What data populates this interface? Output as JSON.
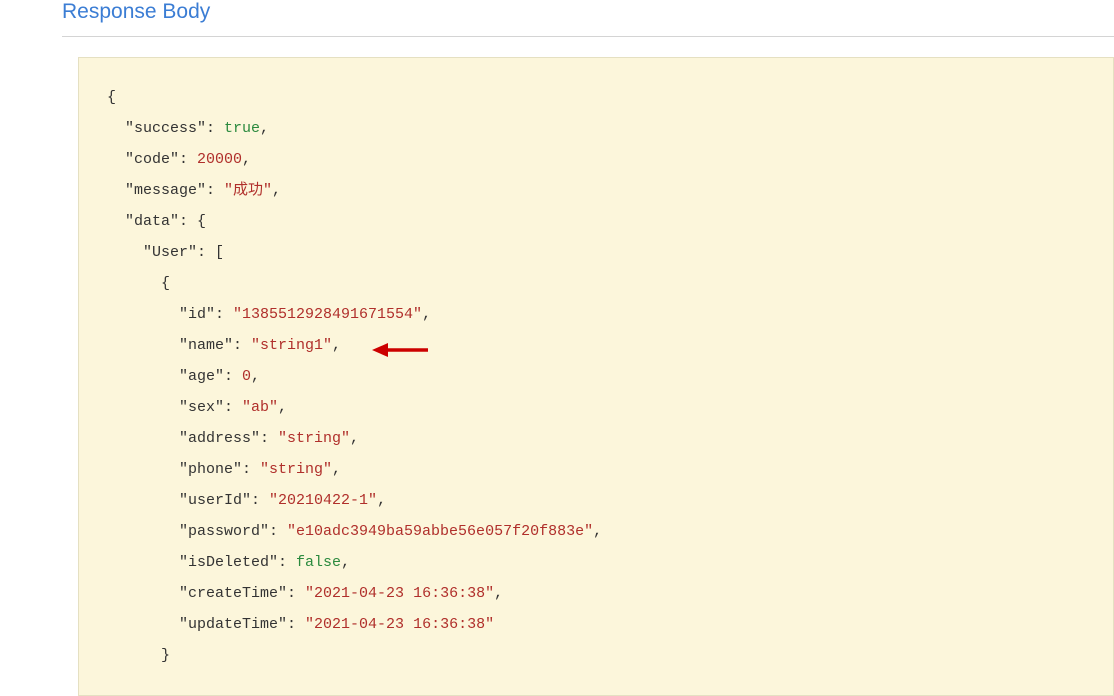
{
  "section": {
    "title": "Response Body"
  },
  "response": {
    "success_key": "\"success\"",
    "success_value": "true",
    "code_key": "\"code\"",
    "code_value": "20000",
    "message_key": "\"message\"",
    "message_value": "\"成功\"",
    "data_key": "\"data\"",
    "user_key": "\"User\"",
    "fields": {
      "id_key": "\"id\"",
      "id_value": "\"1385512928491671554\"",
      "name_key": "\"name\"",
      "name_value": "\"string1\"",
      "age_key": "\"age\"",
      "age_value": "0",
      "sex_key": "\"sex\"",
      "sex_value": "\"ab\"",
      "address_key": "\"address\"",
      "address_value": "\"string\"",
      "phone_key": "\"phone\"",
      "phone_value": "\"string\"",
      "userId_key": "\"userId\"",
      "userId_value": "\"20210422-1\"",
      "password_key": "\"password\"",
      "password_value": "\"e10adc3949ba59abbe56e057f20f883e\"",
      "isDeleted_key": "\"isDeleted\"",
      "isDeleted_value": "false",
      "createTime_key": "\"createTime\"",
      "createTime_value": "\"2021-04-23 16:36:38\"",
      "updateTime_key": "\"updateTime\"",
      "updateTime_value": "\"2021-04-23 16:36:38\""
    }
  },
  "punct": {
    "open_brace": "{",
    "close_brace": "}",
    "open_bracket": "[",
    "colon_space": ": ",
    "comma": ","
  }
}
